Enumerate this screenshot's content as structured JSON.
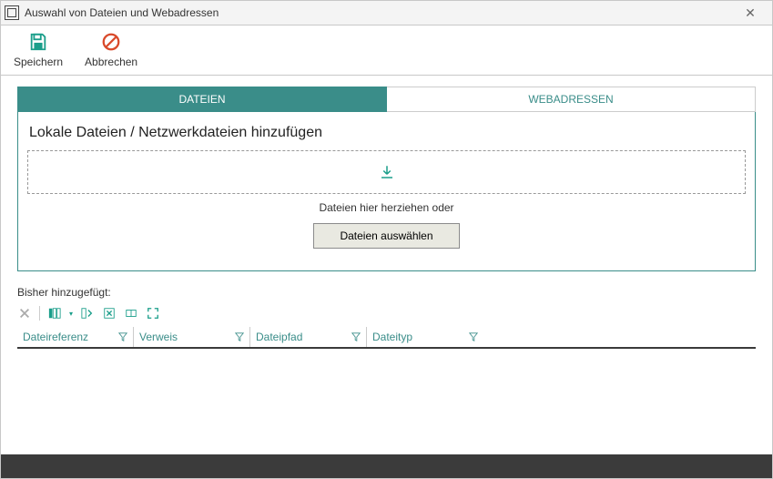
{
  "window": {
    "title": "Auswahl von Dateien und Webadressen"
  },
  "toolbar": {
    "save_label": "Speichern",
    "cancel_label": "Abbrechen"
  },
  "tabs": {
    "files": "DATEIEN",
    "web": "WEBADRESSEN"
  },
  "panel": {
    "title": "Lokale Dateien / Netzwerkdateien hinzufügen",
    "drop_hint": "Dateien hier herziehen oder",
    "choose_label": "Dateien auswählen"
  },
  "added": {
    "label": "Bisher hinzugefügt:"
  },
  "grid": {
    "columns": [
      "Dateireferenz",
      "Verweis",
      "Dateipfad",
      "Dateityp"
    ]
  }
}
